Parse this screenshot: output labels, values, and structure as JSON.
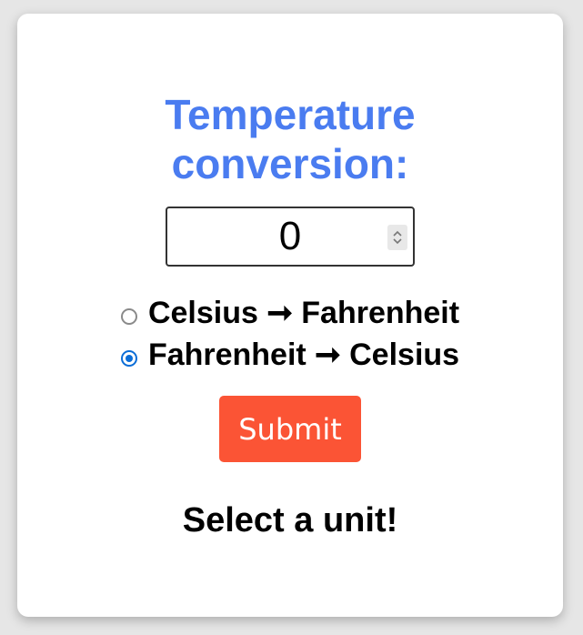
{
  "title": {
    "line1": "Temperature",
    "line2": "conversion:"
  },
  "input": {
    "value": "0",
    "type": "number"
  },
  "options": [
    {
      "label": "Celsius ➞ Fahrenheit",
      "selected": false
    },
    {
      "label": "Fahrenheit ➞ Celsius",
      "selected": true
    }
  ],
  "submit_label": "Submit",
  "message": "Select a unit!",
  "colors": {
    "title": "#4a7cf0",
    "button": "#fb5435",
    "radio_selected": "#0b6dd7",
    "background": "#e6e6e6",
    "card": "#ffffff"
  }
}
